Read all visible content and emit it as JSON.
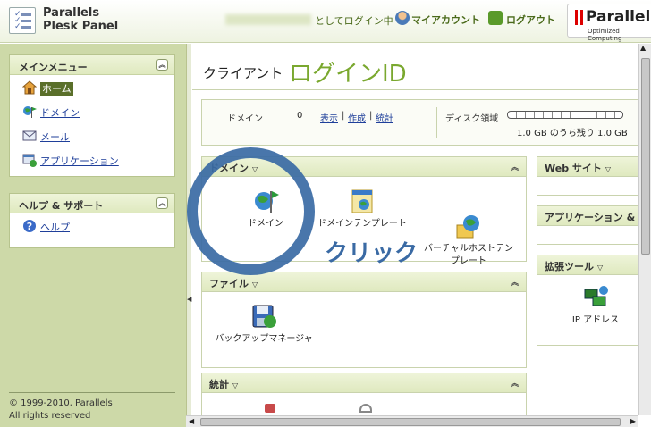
{
  "header": {
    "app_name_line1": "Parallels",
    "app_name_line2": "Plesk Panel",
    "logged_in_suffix": "としてログイン中",
    "my_account": "マイアカウント",
    "logout": "ログアウト",
    "brand_name": "Parallels",
    "brand_tagline": "Optimized Computing"
  },
  "sidebar": {
    "main_menu_title": "メインメニュー",
    "main_menu_items": [
      {
        "label": "ホーム",
        "icon": "home-icon"
      },
      {
        "label": "ドメイン",
        "icon": "domain-flag-icon"
      },
      {
        "label": "メール",
        "icon": "mail-icon"
      },
      {
        "label": "アプリケーション",
        "icon": "application-icon"
      }
    ],
    "help_title": "ヘルプ & サポート",
    "help_items": [
      {
        "label": "ヘルプ",
        "icon": "help-icon"
      }
    ],
    "copyright_line1": "© 1999-2010, Parallels",
    "copyright_line2": "All rights reserved"
  },
  "main": {
    "page_title": "クライアント",
    "login_id": "ログインID",
    "stats": {
      "domain_label": "ドメイン",
      "domain_count": "0",
      "view_link": "表示",
      "create_link": "作成",
      "stats_link": "統計",
      "separator": "|",
      "disk_label": "ディスク領域",
      "disk_text": "1.0 GB のうち残り 1.0 GB",
      "disk_used_fraction": 0.0
    },
    "groups": {
      "domains": {
        "title": "ドメイン",
        "tools": [
          "ドメイン",
          "ドメインテンプレート",
          "バーチャルホストテン\nプレート"
        ]
      },
      "files": {
        "title": "ファイル",
        "tools": [
          "バックアップマネージャ"
        ]
      },
      "stats": {
        "title": "統計"
      }
    },
    "right_groups": {
      "web_sites": {
        "title": "Web サイト"
      },
      "apps": {
        "title": "アプリケーション &"
      },
      "extensions": {
        "title": "拡張ツール",
        "tools": [
          "IP アドレス"
        ]
      }
    },
    "annotation": "クリック"
  },
  "colors": {
    "accent_green": "#7aa82f",
    "sidebar_bg": "#cdd9a8",
    "annotation_blue": "#3a6aa4",
    "link_blue": "#1f3f9a"
  }
}
